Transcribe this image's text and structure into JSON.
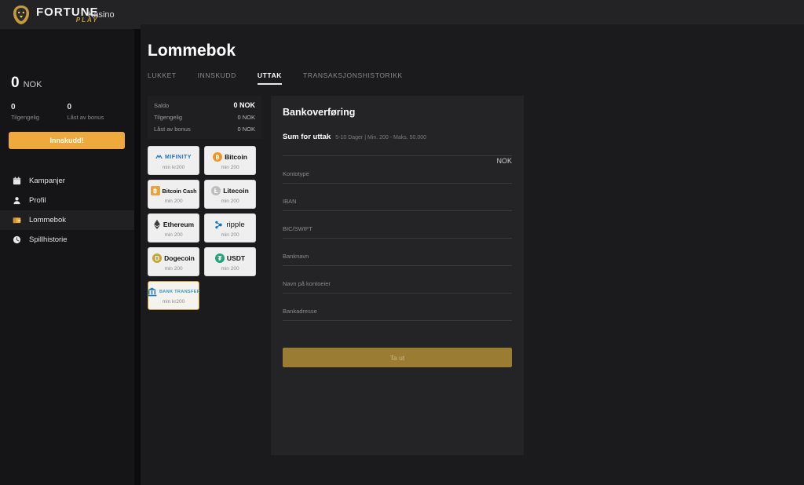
{
  "topbar": {
    "logo_main": "FORTUNE",
    "logo_sub": "PLAY",
    "logo_icon": "lion-head-icon",
    "nav_item": "Kasino"
  },
  "sidebar": {
    "balance": {
      "amount": "0",
      "currency": "NOK",
      "available_value": "0",
      "available_label": "Tilgengelig",
      "locked_value": "0",
      "locked_label": "Låst av bonus"
    },
    "deposit_button": "Innskudd!",
    "items": [
      {
        "label": "Kampanjer",
        "icon": "calendar-icon",
        "active": false
      },
      {
        "label": "Profil",
        "icon": "person-icon",
        "active": false
      },
      {
        "label": "Lommebok",
        "icon": "wallet-icon",
        "active": true
      },
      {
        "label": "Spillhistorie",
        "icon": "clock-icon",
        "active": false
      }
    ]
  },
  "main": {
    "title": "Lommebok",
    "tabs": [
      {
        "label": "LUKKET",
        "active": false
      },
      {
        "label": "INNSKUDD",
        "active": false
      },
      {
        "label": "UTTAK",
        "active": true
      },
      {
        "label": "TRANSAKSJONSHISTORIKK",
        "active": false
      }
    ],
    "balance_rows": [
      {
        "label": "Saldo",
        "value": "0 NOK"
      },
      {
        "label": "Tilgengelig",
        "value": "0 NOK"
      },
      {
        "label": "Låst av bonus",
        "value": "0 NOK"
      }
    ],
    "methods": [
      {
        "name": "MIFINITY",
        "min": "min kr200",
        "icon": "mifinity-logo",
        "color": "#1f6fc4",
        "symbol": "",
        "selected": false
      },
      {
        "name": "Bitcoin",
        "min": "min 200",
        "icon": "bitcoin-icon",
        "color": "#f7931a",
        "symbol": "฿",
        "selected": false
      },
      {
        "name": "Bitcoin Cash",
        "min": "min 200",
        "icon": "bitcoin-cash-icon",
        "color": "#e8a33d",
        "symbol": "฿",
        "selected": false
      },
      {
        "name": "Litecoin",
        "min": "min 200",
        "icon": "litecoin-icon",
        "color": "#bebebe",
        "symbol": "Ł",
        "selected": false
      },
      {
        "name": "Ethereum",
        "min": "min 200",
        "icon": "ethereum-icon",
        "color": "#3c3c3d",
        "symbol": "♦",
        "selected": false
      },
      {
        "name": "ripple",
        "min": "min 200",
        "icon": "ripple-icon",
        "color": "#0e72c3",
        "symbol": "✤",
        "selected": false
      },
      {
        "name": "Dogecoin",
        "min": "min 200",
        "icon": "dogecoin-icon",
        "color": "#c3a634",
        "symbol": "D",
        "selected": false
      },
      {
        "name": "USDT",
        "min": "min 200",
        "icon": "usdt-icon",
        "color": "#26a17b",
        "symbol": "₮",
        "selected": false
      },
      {
        "name": "BANK TRANSFER",
        "min": "min kr200",
        "icon": "bank-transfer-icon",
        "color": "#1f7ab4",
        "symbol": "🏛",
        "selected": true
      }
    ],
    "form": {
      "title": "Bankoverføring",
      "amount_label": "Sum for uttak",
      "amount_meta": "5-10 Dager | Min. 200 - Maks. 50.000",
      "amount_currency": "NOK",
      "amount_value": "",
      "fields": [
        {
          "label": "Kontotype",
          "value": ""
        },
        {
          "label": "IBAN",
          "value": ""
        },
        {
          "label": "BIC/SWIFT",
          "value": ""
        },
        {
          "label": "Banknavn",
          "value": ""
        },
        {
          "label": "Navn på kontoeier",
          "value": ""
        },
        {
          "label": "Bankadresse",
          "value": ""
        }
      ],
      "submit_label": "Ta ut"
    }
  },
  "colors": {
    "accent": "#f0a93b",
    "gold": "#c79a3a",
    "panel": "#1b1b1d",
    "card": "#242426"
  }
}
